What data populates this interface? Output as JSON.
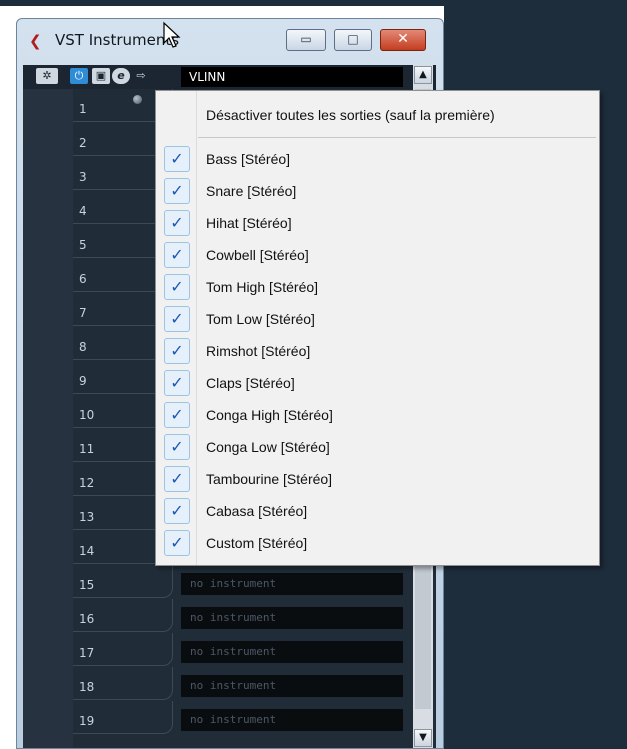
{
  "window": {
    "title": "VST Instruments",
    "minimize_icon": "minimize-icon",
    "maximize_icon": "maximize-icon",
    "close_icon": "close-icon",
    "minimize_glyph": "▭",
    "maximize_glyph": "□",
    "close_glyph": "✕"
  },
  "toolbar": {
    "instrument_name": "VLINN",
    "gear_glyph": "✲",
    "power_glyph": "⏻",
    "window_glyph": "▣",
    "edit_glyph": "e",
    "output_glyph": "⇨"
  },
  "scrollbar": {
    "up_glyph": "▲",
    "down_glyph": "▼"
  },
  "slots": [
    {
      "number": "1",
      "instrument": ""
    },
    {
      "number": "2",
      "instrument": ""
    },
    {
      "number": "3",
      "instrument": ""
    },
    {
      "number": "4",
      "instrument": ""
    },
    {
      "number": "5",
      "instrument": ""
    },
    {
      "number": "6",
      "instrument": ""
    },
    {
      "number": "7",
      "instrument": ""
    },
    {
      "number": "8",
      "instrument": ""
    },
    {
      "number": "9",
      "instrument": ""
    },
    {
      "number": "10",
      "instrument": ""
    },
    {
      "number": "11",
      "instrument": ""
    },
    {
      "number": "12",
      "instrument": ""
    },
    {
      "number": "13",
      "instrument": ""
    },
    {
      "number": "14",
      "instrument": ""
    },
    {
      "number": "15",
      "instrument": "no instrument"
    },
    {
      "number": "16",
      "instrument": "no instrument"
    },
    {
      "number": "17",
      "instrument": "no instrument"
    },
    {
      "number": "18",
      "instrument": "no instrument"
    },
    {
      "number": "19",
      "instrument": "no instrument"
    }
  ],
  "context_menu": {
    "top_item": "Désactiver toutes les sorties (sauf la première)",
    "check_glyph": "✓",
    "items": [
      {
        "label": "Bass [Stéréo]",
        "checked": true
      },
      {
        "label": "Snare [Stéréo]",
        "checked": true
      },
      {
        "label": "Hihat [Stéréo]",
        "checked": true
      },
      {
        "label": "Cowbell [Stéréo]",
        "checked": true
      },
      {
        "label": "Tom High [Stéréo]",
        "checked": true
      },
      {
        "label": "Tom Low [Stéréo]",
        "checked": true
      },
      {
        "label": "Rimshot [Stéréo]",
        "checked": true
      },
      {
        "label": "Claps [Stéréo]",
        "checked": true
      },
      {
        "label": "Conga High [Stéréo]",
        "checked": true
      },
      {
        "label": "Conga Low [Stéréo]",
        "checked": true
      },
      {
        "label": "Tambourine [Stéréo]",
        "checked": true
      },
      {
        "label": "Cabasa [Stéréo]",
        "checked": true
      },
      {
        "label": "Custom [Stéréo]",
        "checked": true
      }
    ]
  }
}
